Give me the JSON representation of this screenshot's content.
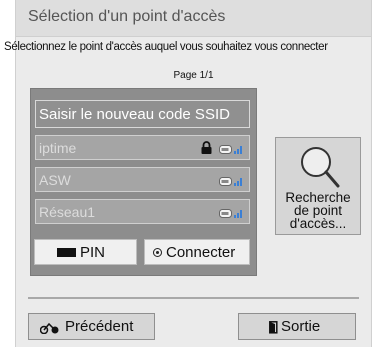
{
  "dialog": {
    "title": "Sélection d'un point d'accès",
    "instruction": "Sélectionnez le point d'accès auquel vous souhaitez vous connecter",
    "page_indicator": "Page 1/1"
  },
  "networks": {
    "new_ssid_label": "Saisir le nouveau code SSID",
    "items": [
      {
        "ssid": "iptime",
        "locked": true,
        "icon": "wifi-signal-icon"
      },
      {
        "ssid": "ASW",
        "locked": false,
        "icon": "wifi-signal-icon"
      },
      {
        "ssid": "Réseau1",
        "locked": false,
        "icon": "wifi-signal-icon"
      }
    ]
  },
  "buttons": {
    "pin_label": "PIN",
    "connect_label": "Connecter",
    "search_label": "Recherche de point d'accès...",
    "previous_label": "Précédent",
    "exit_label": "Sortie"
  },
  "colors": {
    "panel_bg": "#8d8d8d",
    "row_bg": "#a5a5a5",
    "signal_bars": "#3a7fd5",
    "dialog_bg": "#ebebeb"
  }
}
